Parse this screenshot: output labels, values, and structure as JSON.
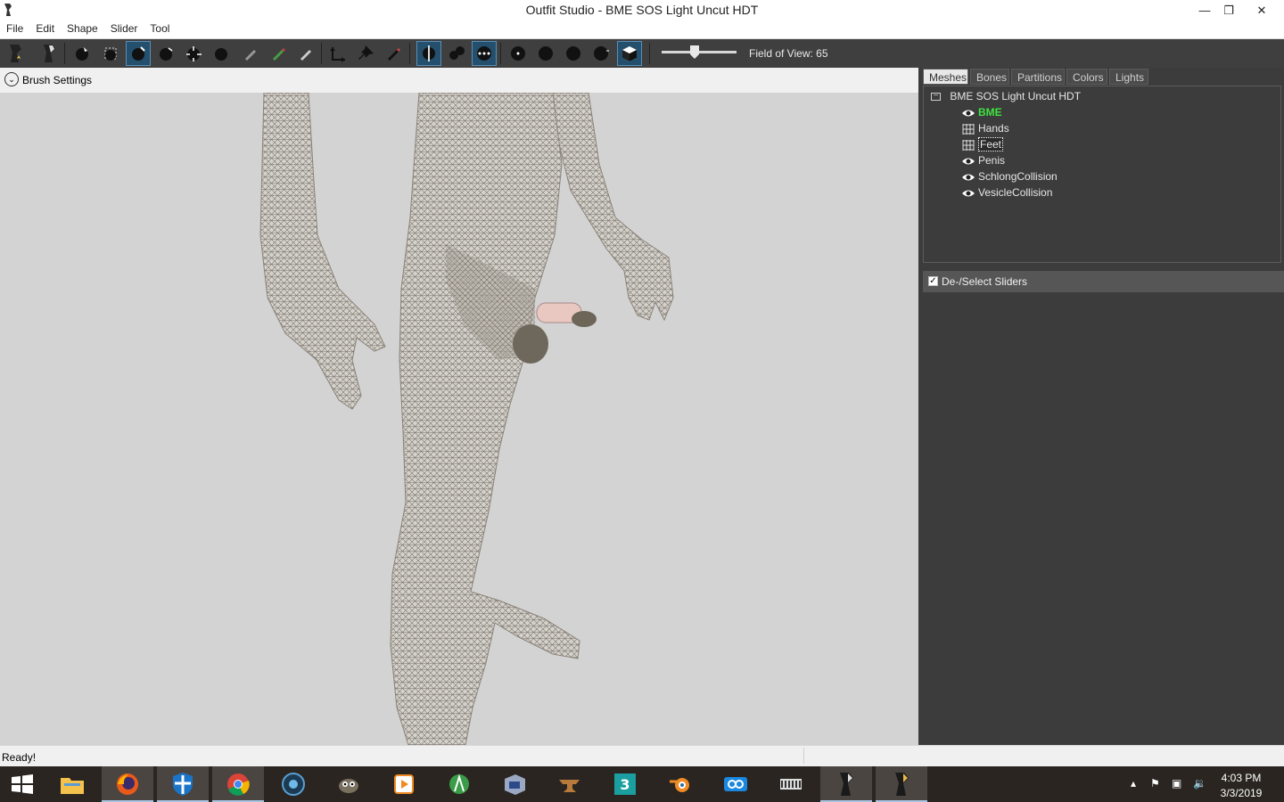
{
  "window": {
    "title": "Outfit Studio - BME SOS Light Uncut HDT"
  },
  "menu": [
    "File",
    "Edit",
    "Shape",
    "Slider",
    "Tool"
  ],
  "toolbar": {
    "fov_label": "Field of View: 65",
    "fov_value": 65
  },
  "brush_settings": {
    "label": "Brush Settings"
  },
  "tabs": [
    {
      "label": "Meshes",
      "active": true
    },
    {
      "label": "Bones",
      "active": false
    },
    {
      "label": "Partitions",
      "active": false
    },
    {
      "label": "Colors",
      "active": false
    },
    {
      "label": "Lights",
      "active": false
    }
  ],
  "mesh_tree": {
    "root": "BME SOS Light Uncut HDT",
    "items": [
      {
        "label": "BME",
        "icon": "eye-icon",
        "highlight": true
      },
      {
        "label": "Hands",
        "icon": "grid-icon"
      },
      {
        "label": "Feet",
        "icon": "grid-icon",
        "selected": true
      },
      {
        "label": "Penis",
        "icon": "eye-icon"
      },
      {
        "label": "SchlongCollision",
        "icon": "eye-icon"
      },
      {
        "label": "VesicleCollision",
        "icon": "eye-icon"
      }
    ]
  },
  "sliders": {
    "label": "De-/Select Sliders",
    "checked": true
  },
  "status": {
    "text": "Ready!"
  },
  "taskbar": {
    "time": "4:03 PM",
    "date": "3/3/2019"
  },
  "colors": {
    "toolbar_bg": "#3f3f3f",
    "highlight_green": "#3fe33f",
    "panel_bg": "#3c3c3c",
    "viewport_bg": "#d3d3d3"
  }
}
